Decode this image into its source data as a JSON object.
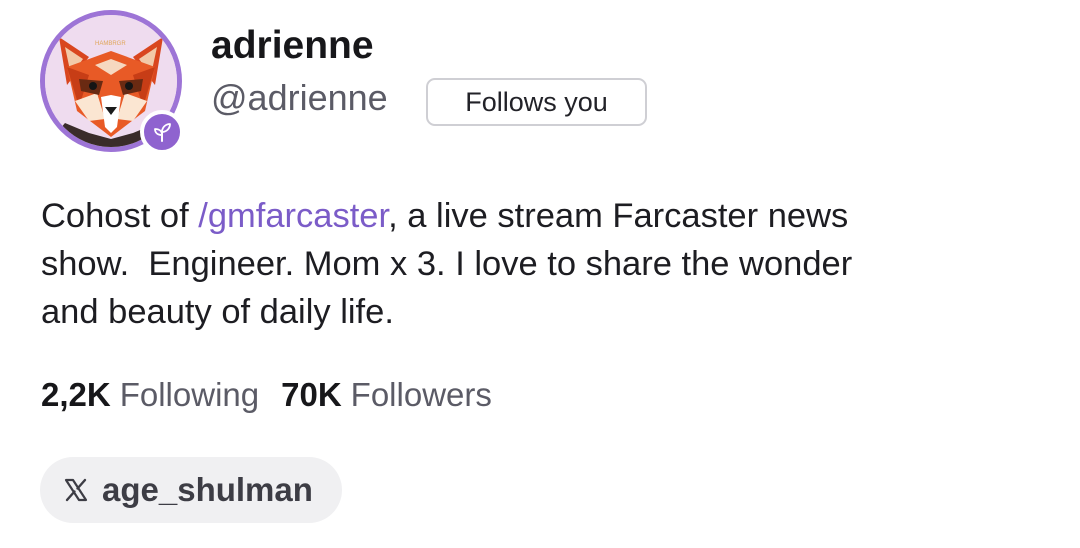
{
  "profile": {
    "display_name": "adrienne",
    "username": "@adrienne",
    "follows_you_label": "Follows you",
    "avatar_icon": "red-panda-avatar",
    "avatar_sign_text": "HAMBRGR",
    "badge_icon": "sprout-icon"
  },
  "bio": {
    "line1_prefix": "Cohost of ",
    "mention": "/gmfarcaster",
    "line1_suffix": ", a live stream Farcaster news",
    "line2": "show.  Engineer. Mom x 3. I love to share the wonder",
    "line3": "and beauty of daily life."
  },
  "stats": {
    "following_count": "2,2K",
    "following_label": "Following",
    "followers_count": "70K",
    "followers_label": "Followers"
  },
  "social": {
    "x_icon": "x-logo-icon",
    "x_handle": "age_shulman"
  },
  "colors": {
    "accent": "#7b5cc8",
    "badge": "#8f63cf",
    "avatar_ring": "#9d74d6"
  }
}
